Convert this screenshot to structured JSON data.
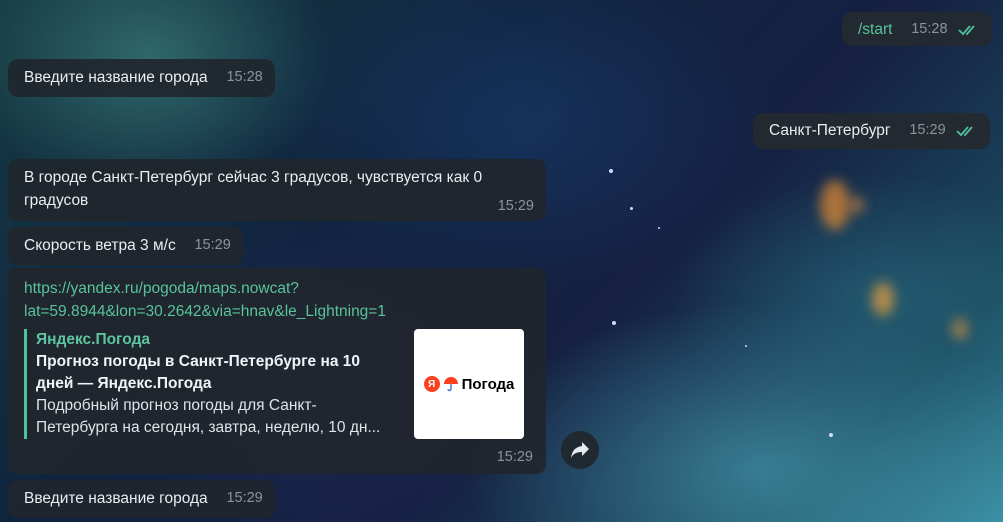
{
  "messages": {
    "m1": {
      "text": "/start",
      "time": "15:28"
    },
    "m2": {
      "text": "Введите название города",
      "time": "15:28"
    },
    "m3": {
      "text": "Санкт-Петербург",
      "time": "15:29"
    },
    "m4": {
      "line1": "В городе Санкт-Петербург сейчас 3 градусов, чувствуется как 0",
      "line2": "градусов",
      "time": "15:29"
    },
    "m5": {
      "text": "Скорость ветра 3 м/с",
      "time": "15:29"
    },
    "m6": {
      "link_line1": "https://yandex.ru/pogoda/maps.nowcat?",
      "link_line2": "lat=59.8944&lon=30.2642&via=hnav&le_Lightning=1",
      "preview": {
        "site": "Яндекс.Погода",
        "title_line1": "Прогноз погоды в Санкт-Петербурге на 10",
        "title_line2": "дней — Яндекс.Погода",
        "desc_line1": "Подробный прогноз погоды для Санкт-",
        "desc_line2": "Петербурга на сегодня, завтра, неделю, 10 дн...",
        "thumb_letter": "Я",
        "thumb_word": "Погода"
      },
      "time": "15:29"
    },
    "m7": {
      "text": "Введите название города",
      "time": "15:29"
    }
  },
  "icons": {
    "read": "double-check-icon",
    "share": "share-arrow-icon",
    "umbrella": "umbrella-icon"
  },
  "colors": {
    "accent": "#59c39b",
    "check": "#4fc29a",
    "bubble": "#21262c",
    "brand_red": "#fc3f1d"
  }
}
